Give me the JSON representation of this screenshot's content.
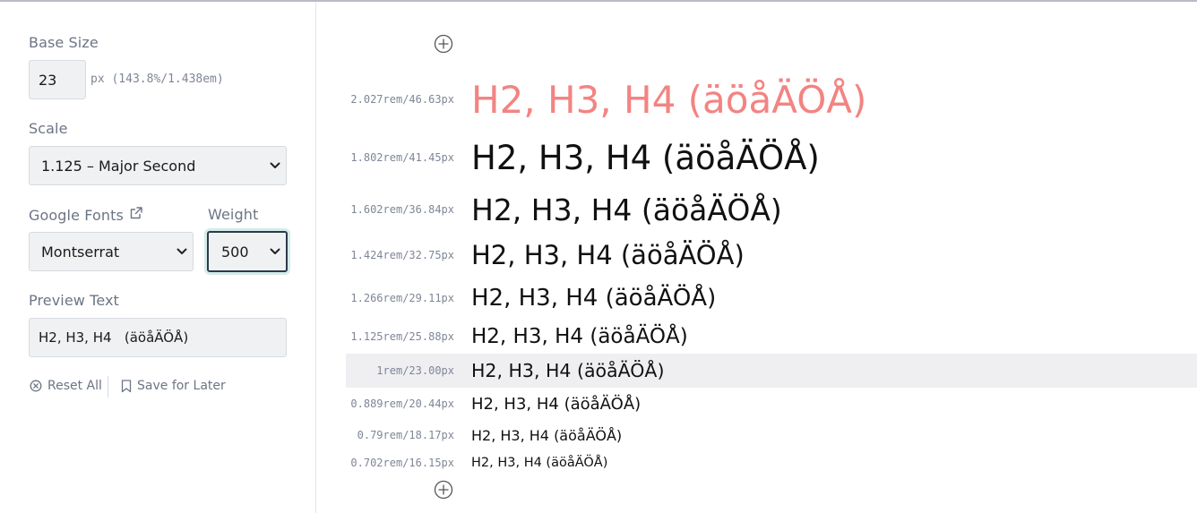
{
  "sidebar": {
    "base_size": {
      "label": "Base Size",
      "value": "23",
      "hint": "px (143.8%/1.438em)"
    },
    "scale": {
      "label": "Scale",
      "selected": "1.125 – Major Second"
    },
    "fonts": {
      "label": "Google Fonts",
      "selected": "Montserrat",
      "icon": "external-link-icon"
    },
    "weight": {
      "label": "Weight",
      "selected": "500"
    },
    "preview": {
      "label": "Preview Text",
      "value": "H2, H3, H4   (äöåÄÖÅ)"
    },
    "actions": {
      "reset_label": "Reset All",
      "save_label": "Save for Later"
    }
  },
  "preview": {
    "accent_color": "#f28482",
    "rows": [
      {
        "size": "2.027rem/46.63px",
        "text": "H2, H3, H4 (äöåÄÖÅ)"
      },
      {
        "size": "1.802rem/41.45px",
        "text": "H2, H3, H4 (äöåÄÖÅ)"
      },
      {
        "size": "1.602rem/36.84px",
        "text": "H2, H3, H4 (äöåÄÖÅ)"
      },
      {
        "size": "1.424rem/32.75px",
        "text": "H2, H3, H4 (äöåÄÖÅ)"
      },
      {
        "size": "1.266rem/29.11px",
        "text": "H2, H3, H4 (äöåÄÖÅ)"
      },
      {
        "size": "1.125rem/25.88px",
        "text": "H2, H3, H4 (äöåÄÖÅ)"
      },
      {
        "size": "1rem/23.00px",
        "text": "H2, H3, H4 (äöåÄÖÅ)"
      },
      {
        "size": "0.889rem/20.44px",
        "text": "H2, H3, H4 (äöåÄÖÅ)"
      },
      {
        "size": "0.79rem/18.17px",
        "text": "H2, H3, H4 (äöåÄÖÅ)"
      },
      {
        "size": "0.702rem/16.15px",
        "text": "H2, H3, H4 (äöåÄÖÅ)"
      }
    ]
  }
}
